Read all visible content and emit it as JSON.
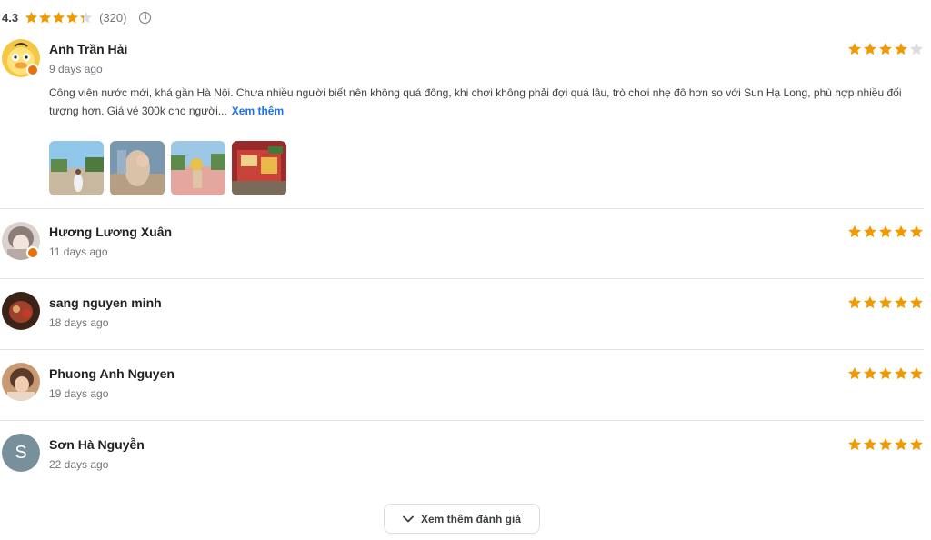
{
  "summary": {
    "rating_text": "4.3",
    "rating_value": 4.3,
    "count_text": "(320)",
    "info_icon": "info-icon"
  },
  "colors": {
    "star_filled": "#f29900",
    "star_empty": "#dadce0",
    "link": "#1a73e8"
  },
  "reviews": [
    {
      "name": "Anh Trần Hải",
      "time": "9 days ago",
      "rating": 4,
      "text": "Công viên nước mới, khá gần Hà Nội. Chưa nhiều người biết nên không quá đông, khi chơi không phải đợi quá lâu, trò chơi nhẹ đô hơn so với Sun Hạ Long, phù hợp nhiều đối tượng hơn. Giá vé 300k cho người...",
      "more_label": "Xem thêm",
      "photo_count": 4
    },
    {
      "name": "Hương Lương Xuân",
      "time": "11 days ago",
      "rating": 5
    },
    {
      "name": "sang nguyen minh",
      "time": "18 days ago",
      "rating": 5
    },
    {
      "name": "Phuong Anh Nguyen",
      "time": "19 days ago",
      "rating": 5
    },
    {
      "name": "Sơn Hà Nguyễn",
      "time": "22 days ago",
      "rating": 5,
      "avatar_letter": "S"
    }
  ],
  "load_more_label": "Xem thêm đánh giá"
}
